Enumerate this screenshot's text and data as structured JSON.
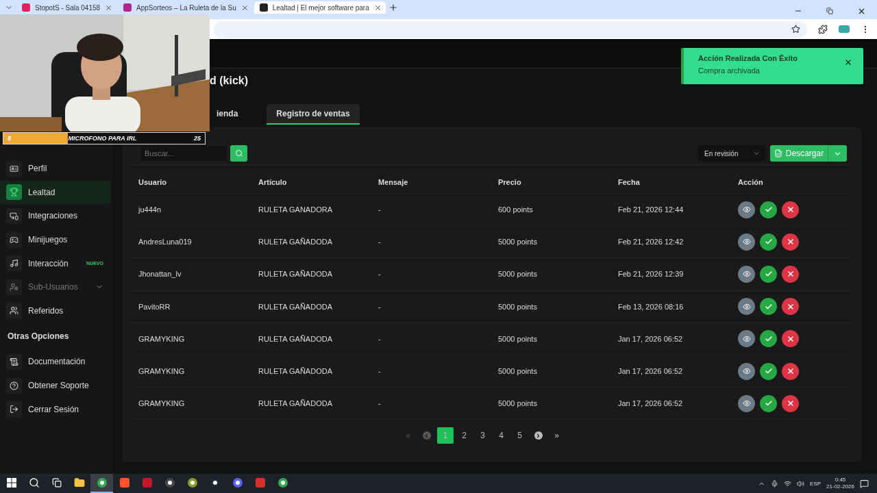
{
  "browser": {
    "tabs": [
      {
        "title": "StopotS - Sala 04158",
        "selected": false
      },
      {
        "title": "AppSorteos – La Ruleta de la Su",
        "selected": false
      },
      {
        "title": "Lealtad | El mejor software para",
        "selected": true
      }
    ]
  },
  "overlay": {
    "goal_bar": {
      "count": "8",
      "label": "MICROFONO PARA IRL",
      "target": "25",
      "level": 0.32
    }
  },
  "toast": {
    "title": "Acción Realizada Con Éxito",
    "message": "Compra archivada"
  },
  "sidebar": {
    "items": [
      {
        "kind": "item",
        "label": "Perfil",
        "selected": false,
        "disabled": false
      },
      {
        "kind": "item",
        "label": "Lealtad",
        "selected": true,
        "disabled": false
      },
      {
        "kind": "item",
        "label": "Integraciones",
        "selected": false,
        "disabled": false
      },
      {
        "kind": "item",
        "label": "Minijuegos",
        "selected": false,
        "disabled": false
      },
      {
        "kind": "item",
        "label": "Interacción",
        "selected": false,
        "disabled": false,
        "badge": "NUEVO"
      },
      {
        "kind": "item",
        "label": "Sub-Usuarios",
        "selected": false,
        "disabled": true,
        "expandable": true
      },
      {
        "kind": "item",
        "label": "Referidos",
        "selected": false,
        "disabled": false
      },
      {
        "kind": "heading",
        "label": "Otras Opciones"
      },
      {
        "kind": "item",
        "label": "Documentación",
        "selected": false,
        "disabled": false
      },
      {
        "kind": "item",
        "label": "Obtener Soporte",
        "selected": false,
        "disabled": false
      },
      {
        "kind": "item",
        "label": "Cerrar Sesión",
        "selected": false,
        "disabled": false
      }
    ]
  },
  "page": {
    "title": "d (kick)",
    "tabs": [
      {
        "label": "ienda",
        "selected": false
      },
      {
        "label": "Registro de ventas",
        "selected": true
      }
    ],
    "search": {
      "placeholder": "Buscar..."
    },
    "filter": {
      "value": "En revisión"
    },
    "download": {
      "label": "Descargar"
    },
    "table": {
      "columns": [
        "Usuario",
        "Artículo",
        "Mensaje",
        "Precio",
        "Fecha",
        "Acción"
      ],
      "rows": [
        [
          "ju444n",
          "RULETA GANADORA",
          "-",
          "600 points",
          "Feb 21, 2026 12:44"
        ],
        [
          "AndresLuna019",
          "RULETA GAÑADODA",
          "-",
          "5000 points",
          "Feb 21, 2026 12:42"
        ],
        [
          "Jhonattan_lv",
          "RULETA GAÑADODA",
          "-",
          "5000 points",
          "Feb 21, 2026 12:39"
        ],
        [
          "PavitoRR",
          "RULETA GAÑADODA",
          "-",
          "5000 points",
          "Feb 13, 2026 08:16"
        ],
        [
          "GRAMYKING",
          "RULETA GAÑADODA",
          "-",
          "5000 points",
          "Jan 17, 2026 06:52"
        ],
        [
          "GRAMYKING",
          "RULETA GAÑADODA",
          "-",
          "5000 points",
          "Jan 17, 2026 06:52"
        ],
        [
          "GRAMYKING",
          "RULETA GAÑADODA",
          "-",
          "5000 points",
          "Jan 17, 2026 06:52"
        ]
      ]
    },
    "pagination": {
      "first": {
        "label": "«",
        "disabled": true
      },
      "prev": {
        "disabled": true
      },
      "pages": [
        {
          "label": "1",
          "selected": true
        },
        {
          "label": "2",
          "selected": false
        },
        {
          "label": "3",
          "selected": false
        },
        {
          "label": "4",
          "selected": false
        },
        {
          "label": "5",
          "selected": false
        }
      ],
      "next": {
        "disabled": false
      },
      "last": {
        "label": "»",
        "disabled": false
      }
    }
  },
  "taskbar": {
    "apps": [
      {
        "selected": false
      },
      {
        "selected": false
      },
      {
        "selected": false
      },
      {
        "selected": true
      },
      {
        "selected": false
      },
      {
        "selected": false
      },
      {
        "selected": false
      },
      {
        "selected": false
      },
      {
        "selected": false
      },
      {
        "selected": false
      },
      {
        "selected": false
      },
      {
        "selected": false
      }
    ],
    "language": "ESP",
    "time": "0:45",
    "date": "21-02-2026"
  }
}
